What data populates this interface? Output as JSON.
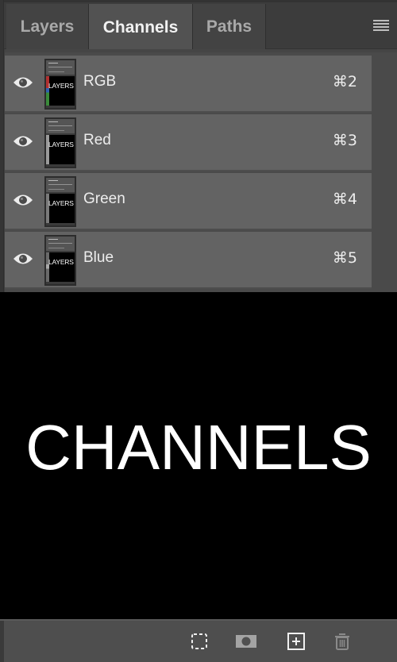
{
  "tabs": [
    {
      "label": "Layers",
      "active": false
    },
    {
      "label": "Channels",
      "active": true
    },
    {
      "label": "Paths",
      "active": false
    }
  ],
  "panel_menu_icon": "hamburger-menu-icon",
  "channels": [
    {
      "name": "RGB",
      "shortcut": "⌘2",
      "visible": true,
      "thumbnail_text": "LAYERS"
    },
    {
      "name": "Red",
      "shortcut": "⌘3",
      "visible": true,
      "thumbnail_text": "LAYERS"
    },
    {
      "name": "Green",
      "shortcut": "⌘4",
      "visible": true,
      "thumbnail_text": "LAYERS"
    },
    {
      "name": "Blue",
      "shortcut": "⌘5",
      "visible": true,
      "thumbnail_text": "LAYERS"
    }
  ],
  "canvas": {
    "text": "CHANNELS"
  },
  "footer_buttons": [
    {
      "name": "load-channel-as-selection",
      "icon": "dashed-selection-icon"
    },
    {
      "name": "save-selection-as-channel",
      "icon": "mask-icon"
    },
    {
      "name": "create-new-channel",
      "icon": "new-channel-icon"
    },
    {
      "name": "delete-channel",
      "icon": "trash-icon"
    }
  ],
  "colors": {
    "active_tab": "#525252",
    "row": "#636363",
    "text": "#ededed"
  }
}
